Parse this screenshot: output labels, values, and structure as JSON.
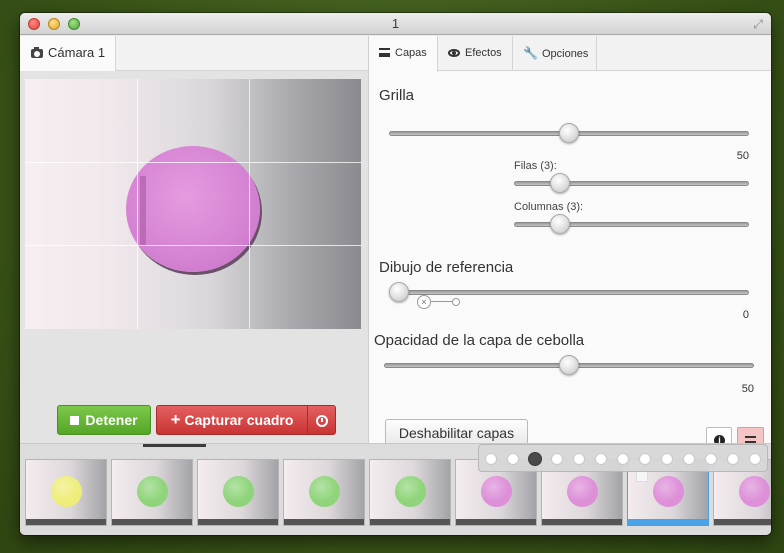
{
  "window": {
    "title": "1"
  },
  "camera": {
    "tab_label": "Cámara 1"
  },
  "controls": {
    "stop_label": "Detener",
    "capture_label": "Capturar cuadro"
  },
  "tabs": [
    {
      "label": "Capas",
      "icon": "list-icon",
      "active": true
    },
    {
      "label": "Efectos",
      "icon": "eye-icon",
      "active": false
    },
    {
      "label": "Opciones",
      "icon": "wrench-icon",
      "active": false
    }
  ],
  "layers": {
    "grid": {
      "label": "Grilla",
      "value": 50,
      "value_text": "50"
    },
    "rows": {
      "label": "Filas (3):",
      "value": 3
    },
    "columns": {
      "label": "Columnas (3):",
      "value": 3
    },
    "reference": {
      "label": "Dibujo de referencia",
      "value": 0,
      "value_text": "0"
    },
    "onion": {
      "label": "Opacidad de la capa de cebolla",
      "value": 50,
      "value_text": "50"
    },
    "disable_label": "Deshabilitar capas"
  },
  "filmstrip": {
    "frames": [
      {
        "ball_color": "#efed7a"
      },
      {
        "ball_color": "#8fd47a"
      },
      {
        "ball_color": "#8fd47a"
      },
      {
        "ball_color": "#8fd47a"
      },
      {
        "ball_color": "#8fd47a"
      },
      {
        "ball_color": "#dd8fd8"
      },
      {
        "ball_color": "#dd8fd8"
      },
      {
        "ball_color": "#dd8fd8",
        "selected": true
      },
      {
        "ball_color": "#dd8fd8"
      }
    ],
    "onion_dots": 13,
    "onion_active_index": 2
  },
  "colors": {
    "accent_green": "#62b335",
    "accent_red": "#d24343",
    "selected_frame": "#4aa3e8"
  }
}
